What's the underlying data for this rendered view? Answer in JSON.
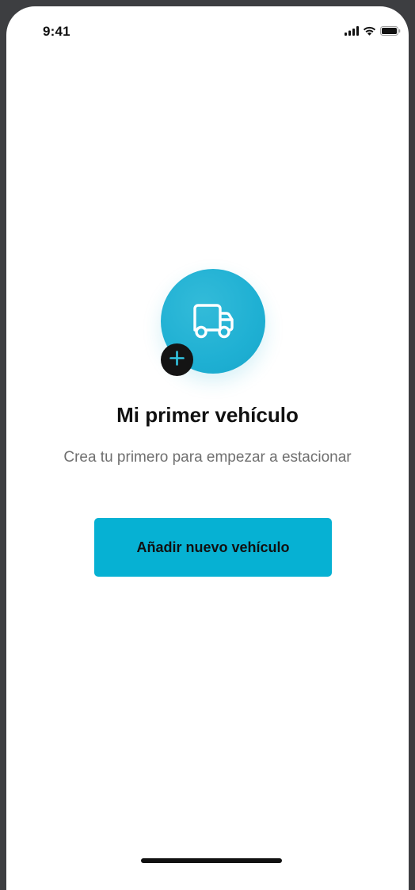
{
  "status_bar": {
    "time": "9:41",
    "icons": [
      "signal-icon",
      "wifi-icon",
      "battery-icon"
    ]
  },
  "empty_state": {
    "icon": "truck-icon",
    "badge_icon": "plus-icon",
    "title": "Mi primer vehículo",
    "subtitle": "Crea tu primero para empezar a estacionar"
  },
  "actions": {
    "add_vehicle_label": "Añadir nuevo vehículo"
  },
  "colors": {
    "accent": "#06b1d3",
    "circle": "#1fb0d3",
    "badge": "#141414",
    "background": "#ffffff",
    "frame": "#3d3e41"
  }
}
